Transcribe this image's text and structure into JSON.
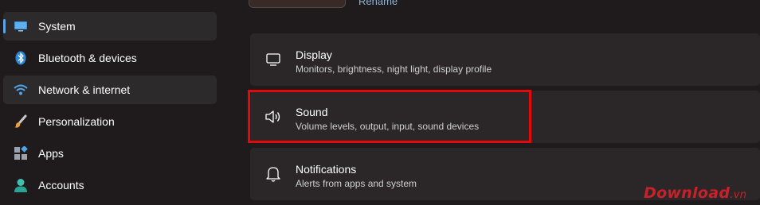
{
  "sidebar": {
    "items": [
      {
        "label": "System",
        "icon": "monitor-icon",
        "state": "active"
      },
      {
        "label": "Bluetooth & devices",
        "icon": "bluetooth-icon",
        "state": "normal"
      },
      {
        "label": "Network & internet",
        "icon": "wifi-icon",
        "state": "hover"
      },
      {
        "label": "Personalization",
        "icon": "paintbrush-icon",
        "state": "normal"
      },
      {
        "label": "Apps",
        "icon": "apps-icon",
        "state": "normal"
      },
      {
        "label": "Accounts",
        "icon": "account-icon",
        "state": "normal"
      }
    ]
  },
  "header": {
    "rename_label": "Rename"
  },
  "cards": [
    {
      "title": "Display",
      "description": "Monitors, brightness, night light, display profile",
      "icon": "display-icon"
    },
    {
      "title": "Sound",
      "description": "Volume levels, output, input, sound devices",
      "icon": "speaker-icon",
      "highlighted": true
    },
    {
      "title": "Notifications",
      "description": "Alerts from apps and system",
      "icon": "bell-icon"
    }
  ],
  "watermark": {
    "text": "Download",
    "suffix": ".vn"
  },
  "colors": {
    "background": "#1f1b1c",
    "card": "#2b2728",
    "accent": "#5aa3e6",
    "highlight": "#e3090a",
    "watermark": "#c9202a"
  }
}
